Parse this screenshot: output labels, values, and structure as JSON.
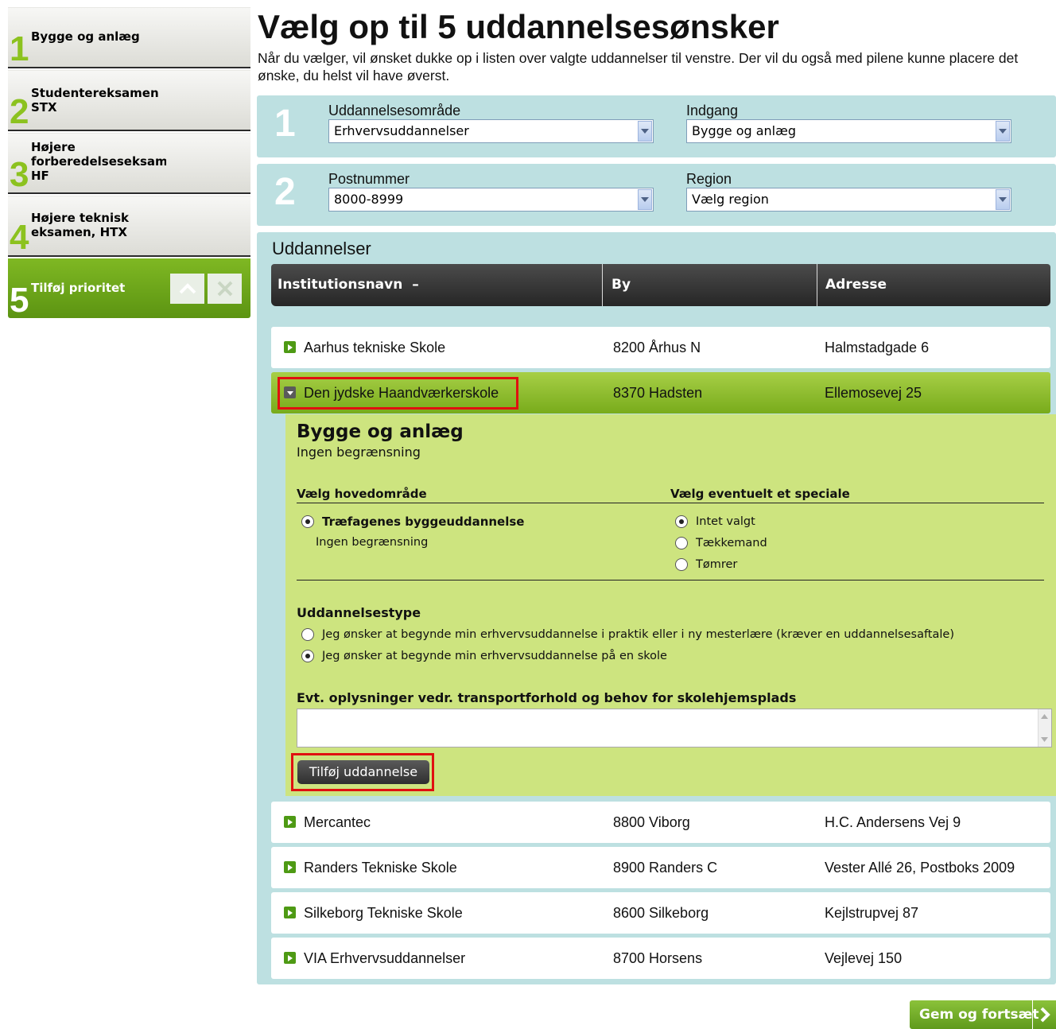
{
  "sidebar": {
    "items": [
      {
        "number": "1",
        "label": "Bygge og anlæg"
      },
      {
        "number": "2",
        "label_line1": "Studentereksamen",
        "label_line2": "STX"
      },
      {
        "number": "3",
        "label_line1": "Højere",
        "label_line2": "forberedelseseksamen",
        "label_line3": "HF"
      },
      {
        "number": "4",
        "label_line1": "Højere teknisk",
        "label_line2": "eksamen, HTX"
      },
      {
        "number": "5",
        "label": "Tilføj prioritet"
      }
    ]
  },
  "header": {
    "title": "Vælg op til 5 uddannelsesønsker",
    "intro": "Når du vælger, vil ønsket dukke op i listen over valgte uddannelser til venstre. Der vil du også med pilene kunne placere det ønske, du helst vil have øverst."
  },
  "filters": {
    "step1": {
      "number": "1",
      "area_label": "Uddannelsesområde",
      "area_value": "Erhvervsuddannelser",
      "entry_label": "Indgang",
      "entry_value": "Bygge og anlæg"
    },
    "step2": {
      "number": "2",
      "postal_label": "Postnummer",
      "postal_value": "8000-8999",
      "region_label": "Region",
      "region_value": "Vælg region"
    }
  },
  "results": {
    "title": "Uddannelser",
    "columns": [
      "Institutionsnavn",
      "By",
      "Adresse"
    ],
    "sort_marker": "–",
    "rows": [
      {
        "name": "Aarhus tekniske Skole",
        "city": "8200 Århus N",
        "address": "Halmstadgade 6"
      },
      {
        "name": "Den jydske Haandværkerskole",
        "city": "8370 Hadsten",
        "address": "Ellemosevej 25"
      },
      {
        "name": "Mercantec",
        "city": "8800 Viborg",
        "address": "H.C. Andersens Vej 9"
      },
      {
        "name": "Randers Tekniske Skole",
        "city": "8900 Randers C",
        "address": "Vester Allé 26, Postboks 2009"
      },
      {
        "name": "Silkeborg Tekniske Skole",
        "city": "8600 Silkeborg",
        "address": "Kejlstrupvej 87"
      },
      {
        "name": "VIA Erhvervsuddannelser",
        "city": "8700 Horsens",
        "address": "Vejlevej 150"
      }
    ],
    "expanded": {
      "title": "Bygge og anlæg",
      "subtitle": "Ingen begrænsning",
      "main_area_heading": "Vælg hovedområde",
      "main_area_option": "Træfagenes byggeuddannelse",
      "main_area_note": "Ingen begrænsning",
      "special_heading": "Vælg eventuelt et speciale",
      "special_options": [
        "Intet valgt",
        "Tækkemand",
        "Tømrer"
      ],
      "type_heading": "Uddannelsestype",
      "type_options": [
        "Jeg ønsker at begynde min erhvervsuddannelse i praktik eller i ny mesterlære (kræver en uddannelsesaftale)",
        "Jeg ønsker at begynde min erhvervsuddannelse på en skole"
      ],
      "notes_heading": "Evt. oplysninger vedr. transportforhold og behov for skolehjemsplads",
      "notes_value": "",
      "add_button": "Tilføj uddannelse"
    }
  },
  "footer": {
    "save_button": "Gem og fortsæt"
  },
  "colors": {
    "accent_green": "#7fb823",
    "panel_blue": "#bde0e1",
    "highlight_red": "#e01010"
  }
}
